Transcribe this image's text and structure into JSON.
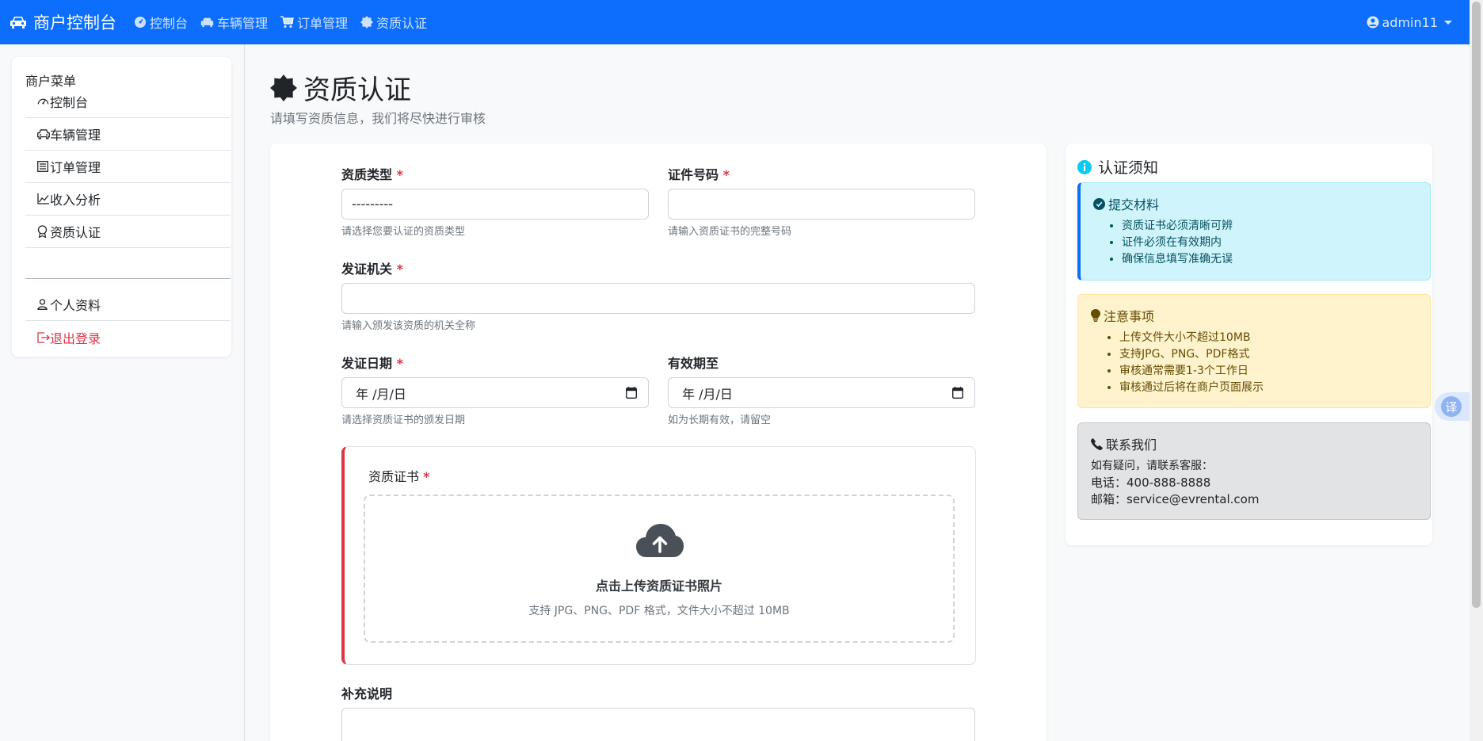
{
  "navbar": {
    "brand": "商户控制台",
    "links": [
      "控制台",
      "车辆管理",
      "订单管理",
      "资质认证"
    ],
    "user": "admin11"
  },
  "sidebar": {
    "title": "商户菜单",
    "items": [
      {
        "label": "控制台",
        "icon": "speedometer-icon"
      },
      {
        "label": "车辆管理",
        "icon": "car-icon"
      },
      {
        "label": "订单管理",
        "icon": "list-icon"
      },
      {
        "label": "收入分析",
        "icon": "chart-icon"
      },
      {
        "label": "资质认证",
        "icon": "award-icon"
      }
    ],
    "items2": [
      {
        "label": "个人资料",
        "icon": "person-icon"
      },
      {
        "label": "退出登录",
        "icon": "logout-icon"
      }
    ]
  },
  "page": {
    "title": "资质认证",
    "subtitle": "请填写资质信息，我们将尽快进行审核"
  },
  "form": {
    "qual_type": {
      "label": "资质类型",
      "required": "*",
      "value": "---------",
      "help": "请选择您要认证的资质类型"
    },
    "cert_no": {
      "label": "证件号码",
      "required": "*",
      "value": "",
      "help": "请输入资质证书的完整号码"
    },
    "issuer": {
      "label": "发证机关",
      "required": "*",
      "value": "",
      "help": "请输入颁发该资质的机关全称"
    },
    "issue_date": {
      "label": "发证日期",
      "required": "*",
      "value": "年 /月/日",
      "help": "请选择资质证书的颁发日期"
    },
    "valid_until": {
      "label": "有效期至",
      "value": "年 /月/日",
      "help": "如为长期有效，请留空"
    },
    "upload": {
      "label": "资质证书",
      "required": "*",
      "title": "点击上传资质证书照片",
      "hint": "支持 JPG、PNG、PDF 格式，文件大小不超过 10MB"
    },
    "remark": {
      "label": "补充说明"
    }
  },
  "info": {
    "title": "认证须知",
    "materials": {
      "title": "提交材料",
      "items": [
        "资质证书必须清晰可辨",
        "证件必须在有效期内",
        "确保信息填写准确无误"
      ]
    },
    "notes": {
      "title": "注意事项",
      "items": [
        "上传文件大小不超过10MB",
        "支持JPG、PNG、PDF格式",
        "审核通常需要1-3个工作日",
        "审核通过后将在商户页面展示"
      ]
    },
    "contact": {
      "title": "联系我们",
      "line1": "如有疑问，请联系客服：",
      "phone": "电话：400-888-8888",
      "email": "邮箱：service@evrental.com"
    }
  },
  "translate": {
    "label": "译"
  },
  "colors": {
    "primary": "#0d6efd",
    "danger": "#dc3545",
    "info_bg": "#cff4fc",
    "warn_bg": "#fff3cd",
    "gray_bg": "#e2e3e5"
  }
}
